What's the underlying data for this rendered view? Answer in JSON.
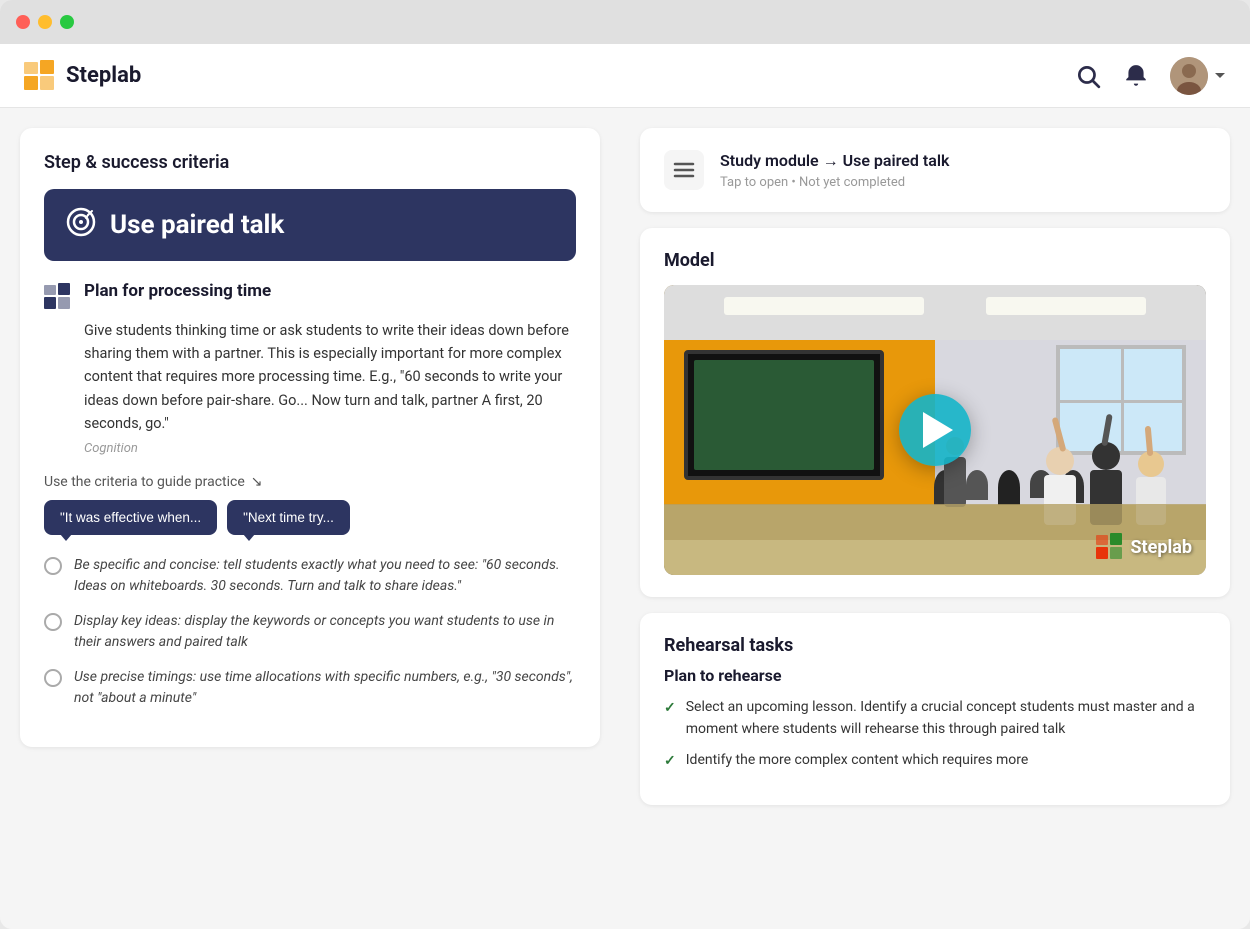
{
  "window": {
    "title": "Steplab"
  },
  "topnav": {
    "brand_name": "Steplab",
    "nav_icons": [
      "search",
      "bell",
      "user"
    ]
  },
  "left_panel": {
    "card_title": "Step & success criteria",
    "step": {
      "title": "Use paired talk",
      "icon": "🎯"
    },
    "criteria": {
      "title": "Plan for processing time",
      "body": "Give students thinking time or ask students to write their ideas down before sharing them with a partner. This is especially important for more complex content that requires more processing time. E.g., \"60 seconds to write your ideas down before pair-share. Go... Now turn and talk, partner A first, 20 seconds, go.\"",
      "tag": "Cognition"
    },
    "guide_label": "Use the criteria to guide practice",
    "feedback_btns": [
      "\"It was effective when...",
      "\"Next time try..."
    ],
    "success_items": [
      "Be specific and concise: tell students exactly what you need to see: \"60 seconds. Ideas on whiteboards. 30 seconds. Turn and talk to share ideas.\"",
      "Display key ideas: display the keywords or concepts you want students to use in their answers and paired talk",
      "Use precise timings: use time allocations with specific numbers, e.g., \"30 seconds\", not \"about a minute\""
    ]
  },
  "right_panel": {
    "breadcrumb": {
      "main": "Study module → Use paired talk",
      "sub": "Tap to open • Not yet completed"
    },
    "model_section": {
      "title": "Model",
      "video_label": "Steplab"
    },
    "rehearsal_section": {
      "title": "Rehearsal tasks",
      "plan_subtitle": "Plan to rehearse",
      "checklist": [
        "Select an upcoming lesson. Identify a crucial concept students must master and a moment where students will rehearse this through paired talk",
        "Identify the more complex content which requires more"
      ]
    }
  }
}
